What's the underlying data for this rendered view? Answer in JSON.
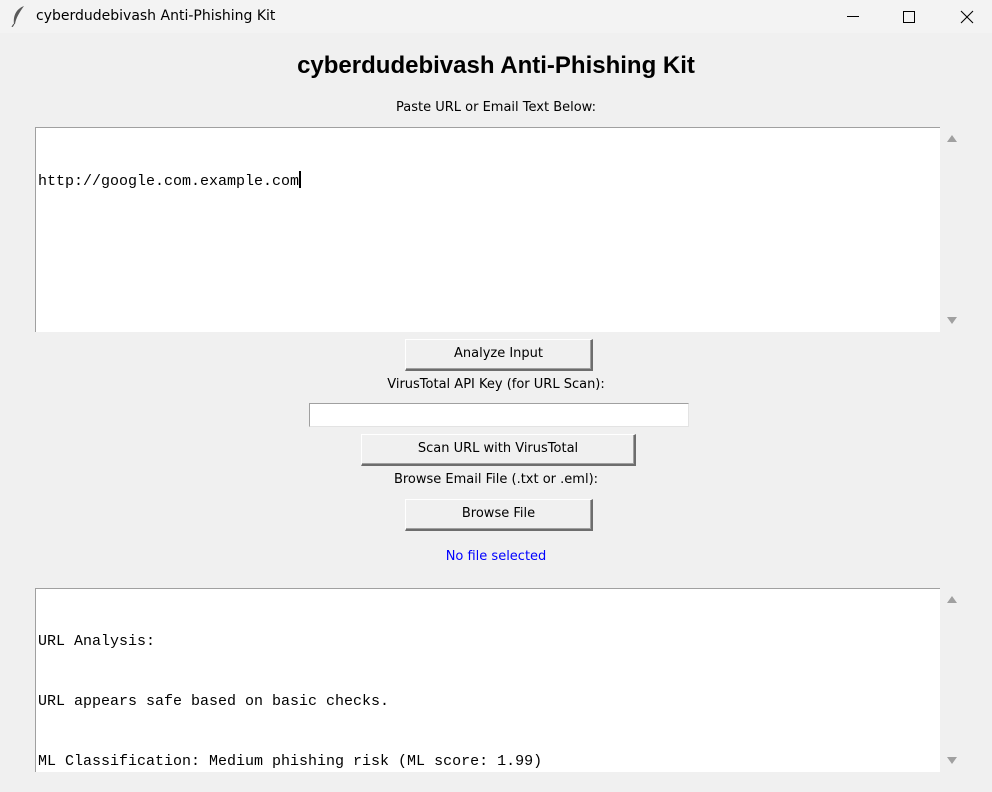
{
  "window": {
    "title": "cyberdudebivash Anti-Phishing Kit",
    "icon": "feather-icon"
  },
  "app": {
    "heading": "cyberdudebivash Anti-Phishing Kit",
    "input_label": "Paste URL or Email Text Below:",
    "input_text": "http://google.com.example.com",
    "analyze_button": "Analyze Input",
    "api_key_label": "VirusTotal API Key (for URL Scan):",
    "api_key_value": "",
    "scan_button": "Scan URL with VirusTotal",
    "browse_label": "Browse Email File (.txt or .eml):",
    "browse_button": "Browse File",
    "file_status": "No file selected",
    "file_status_color": "#0000ff",
    "output_lines": [
      "URL Analysis:",
      "URL appears safe based on basic checks.",
      "ML Classification: Medium phishing risk (ML score: 1.99)"
    ]
  }
}
